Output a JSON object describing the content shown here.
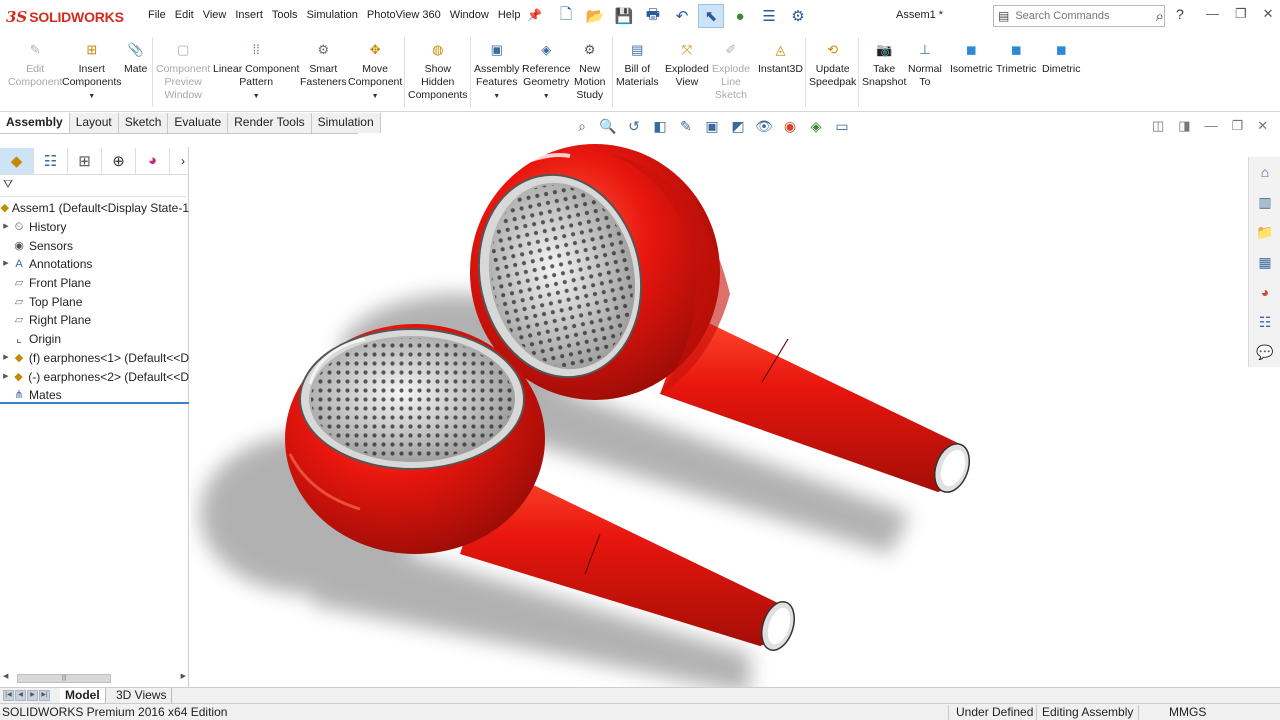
{
  "app": {
    "logo_prefix": "3S",
    "logo_name": "SOLIDWORKS",
    "document_title": "Assem1 *",
    "edition": "SOLIDWORKS Premium 2016 x64 Edition"
  },
  "menu": [
    "File",
    "Edit",
    "View",
    "Insert",
    "Tools",
    "Simulation",
    "PhotoView 360",
    "Window",
    "Help"
  ],
  "search": {
    "placeholder": "Search Commands"
  },
  "help_label": "?",
  "window_controls": [
    "minimize",
    "restore",
    "close"
  ],
  "commands": [
    {
      "label": "Edit\nComponent",
      "icon": "edit-component-icon",
      "enabled": false
    },
    {
      "label": "Insert\nComponents",
      "icon": "insert-components-icon",
      "enabled": true,
      "dropdown": true
    },
    {
      "label": "Mate",
      "icon": "mate-icon",
      "enabled": true
    },
    {
      "label": "Component\nPreview\nWindow",
      "icon": "component-preview-icon",
      "enabled": false
    },
    {
      "label": "Linear Component\nPattern",
      "icon": "linear-pattern-icon",
      "enabled": true,
      "dropdown": true
    },
    {
      "label": "Smart\nFasteners",
      "icon": "smart-fasteners-icon",
      "enabled": true
    },
    {
      "label": "Move\nComponent",
      "icon": "move-component-icon",
      "enabled": true,
      "dropdown": true
    },
    {
      "label": "Show\nHidden\nComponents",
      "icon": "show-hidden-icon",
      "enabled": true
    },
    {
      "label": "Assembly\nFeatures",
      "icon": "assembly-features-icon",
      "enabled": true,
      "dropdown": true
    },
    {
      "label": "Reference\nGeometry",
      "icon": "reference-geometry-icon",
      "enabled": true,
      "dropdown": true
    },
    {
      "label": "New\nMotion\nStudy",
      "icon": "motion-study-icon",
      "enabled": true
    },
    {
      "label": "Bill of\nMaterials",
      "icon": "bill-of-materials-icon",
      "enabled": true
    },
    {
      "label": "Exploded\nView",
      "icon": "exploded-view-icon",
      "enabled": true
    },
    {
      "label": "Explode\nLine\nSketch",
      "icon": "explode-line-icon",
      "enabled": false
    },
    {
      "label": "Instant3D",
      "icon": "instant3d-icon",
      "enabled": true
    },
    {
      "label": "Update\nSpeedpak",
      "icon": "speedpak-icon",
      "enabled": true
    },
    {
      "label": "Take\nSnapshot",
      "icon": "camera-icon",
      "enabled": true
    },
    {
      "label": "Normal\nTo",
      "icon": "normal-to-icon",
      "enabled": true
    },
    {
      "label": "Isometric",
      "icon": "isometric-icon",
      "enabled": true
    },
    {
      "label": "Trimetric",
      "icon": "trimetric-icon",
      "enabled": true
    },
    {
      "label": "Dimetric",
      "icon": "dimetric-icon",
      "enabled": true
    }
  ],
  "tabs": [
    "Assembly",
    "Layout",
    "Sketch",
    "Evaluate",
    "Render Tools",
    "Simulation"
  ],
  "active_tab": "Assembly",
  "tree": [
    {
      "label": "Assem1  (Default<Display State-1",
      "icon": "assembly-icon",
      "expand": false,
      "root": true
    },
    {
      "label": "History",
      "icon": "history-icon",
      "expand": true
    },
    {
      "label": "Sensors",
      "icon": "sensors-icon",
      "expand": false
    },
    {
      "label": "Annotations",
      "icon": "annotations-icon",
      "expand": true
    },
    {
      "label": "Front Plane",
      "icon": "plane-icon",
      "expand": false
    },
    {
      "label": "Top Plane",
      "icon": "plane-icon",
      "expand": false
    },
    {
      "label": "Right Plane",
      "icon": "plane-icon",
      "expand": false
    },
    {
      "label": "Origin",
      "icon": "origin-icon",
      "expand": false
    },
    {
      "label": "(f) earphones<1>  (Default<<D",
      "icon": "part-icon",
      "expand": true
    },
    {
      "label": "(-) earphones<2>  (Default<<D",
      "icon": "part-icon",
      "expand": true
    },
    {
      "label": "Mates",
      "icon": "mates-icon",
      "expand": false
    }
  ],
  "bottom_tabs": [
    "Model",
    "3D Views"
  ],
  "status": {
    "definition": "Under Defined",
    "mode": "Editing Assembly",
    "units": "MMGS"
  },
  "colors": {
    "brand_red": "#d52b1e",
    "earphone_red": "#e8160e",
    "selection_blue": "#cfe3f6"
  }
}
